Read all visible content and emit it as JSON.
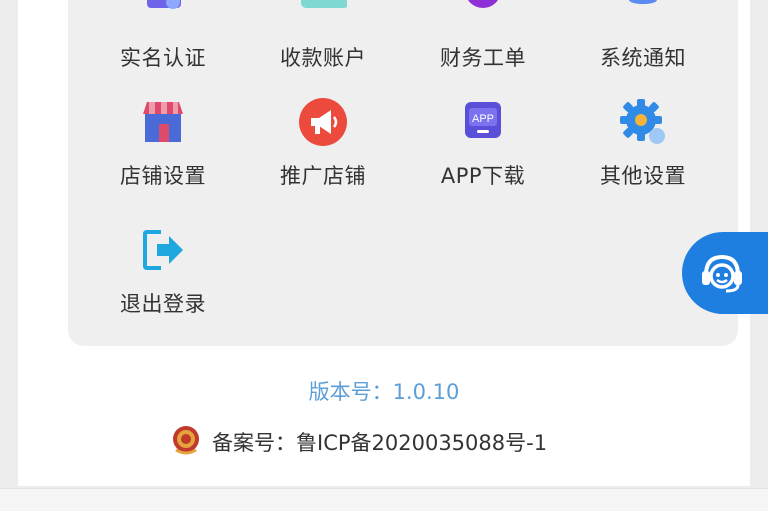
{
  "menu": {
    "row1": [
      {
        "label": "实名认证",
        "icon": "id-verify-icon"
      },
      {
        "label": "收款账户",
        "icon": "collection-account-icon"
      },
      {
        "label": "财务工单",
        "icon": "finance-ticket-icon"
      },
      {
        "label": "系统通知",
        "icon": "bell-icon"
      }
    ],
    "row2": [
      {
        "label": "店铺设置",
        "icon": "store-icon"
      },
      {
        "label": "推广店铺",
        "icon": "megaphone-icon"
      },
      {
        "label": "APP下载",
        "icon": "app-download-icon",
        "badge": "APP"
      },
      {
        "label": "其他设置",
        "icon": "gear-icon"
      }
    ],
    "row3": [
      {
        "label": "退出登录",
        "icon": "logout-icon"
      }
    ]
  },
  "footer": {
    "version": "版本号：1.0.10",
    "icp": "备案号：鲁ICP备2020035088号-1",
    "icp_icon": "police-badge-icon"
  },
  "support": {
    "icon": "customer-service-icon"
  },
  "colors": {
    "accent": "#1e7fe0",
    "version_text": "#5c9fd6",
    "panel_bg": "#efefef"
  }
}
